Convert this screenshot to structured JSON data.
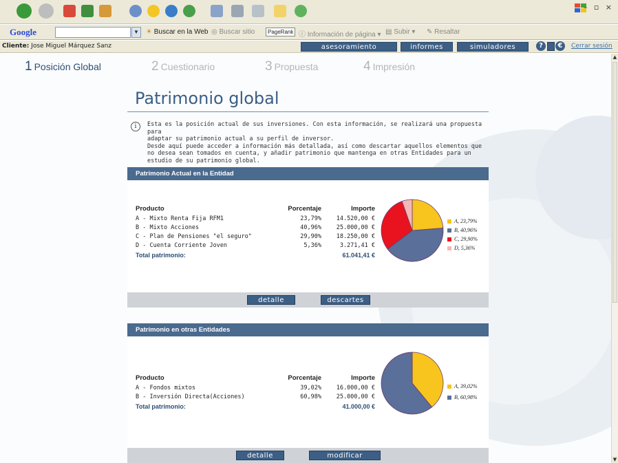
{
  "google": {
    "logo": "Google",
    "search_web": "Buscar en la Web",
    "search_site": "Buscar sitio",
    "pagerank": "PageRank",
    "page_info": "Información de página",
    "up": "Subir",
    "highlight": "Resaltar"
  },
  "app": {
    "client_label": "Cliente:",
    "client_name": "Jose Miguel Márquez Sanz",
    "nav": [
      "asesoramiento",
      "informes",
      "simuladores"
    ],
    "help": "?",
    "euro": "€",
    "logout": "Cerrar sesión"
  },
  "steps": [
    {
      "num": "1",
      "label": "Posición Global"
    },
    {
      "num": "2",
      "label": "Cuestionario"
    },
    {
      "num": "3",
      "label": "Propuesta"
    },
    {
      "num": "4",
      "label": "Impresión"
    }
  ],
  "page_title": "Patrimonio global",
  "intro_lines": [
    "Esta es la posición actual de sus inversiones. Con esta información, se realizará una propuesta para",
    "adaptar su patrimonio actual a su perfil de inversor.",
    "Desde aquí puede acceder a información más detallada, así como descartar aquellos elementos que",
    "no desea sean tomados en cuenta, y añadir patrimonio que mantenga en otras Entidades para un",
    "estudio de su patrimonio global."
  ],
  "panels": [
    {
      "title": "Patrimonio Actual en la Entidad",
      "headers": [
        "Producto",
        "Porcentaje",
        "Importe"
      ],
      "rows": [
        {
          "product": "A - Mixto Renta Fija  RFM1",
          "pct": "23,79%",
          "amount": "14.520,00 €"
        },
        {
          "product": "B - Mixto Acciones",
          "pct": "40,96%",
          "amount": "25.000,00 €"
        },
        {
          "product": "C - Plan de Pensiones \"el seguro\"",
          "pct": "29,90%",
          "amount": "18.250,00 €"
        },
        {
          "product": "D - Cuenta Corriente Joven",
          "pct": "5,36%",
          "amount": "3.271,41 €"
        }
      ],
      "total_label": "Total patrimonio:",
      "total_value": "61.041,41 €",
      "buttons": [
        "detalle",
        "descartes"
      ],
      "legend": [
        "A, 23,79%",
        "B, 40,96%",
        "C, 29,90%",
        "D, 5,36%"
      ]
    },
    {
      "title": "Patrimonio en otras Entidades",
      "headers": [
        "Producto",
        "Porcentaje",
        "Importe"
      ],
      "rows": [
        {
          "product": "A - Fondos mixtos",
          "pct": "39,02%",
          "amount": "16.000,00 €"
        },
        {
          "product": "B - Inversión Directa(Acciones)",
          "pct": "60,98%",
          "amount": "25.000,00 €"
        }
      ],
      "total_label": "Total patrimonio:",
      "total_value": "41.000,00 €",
      "buttons": [
        "detalle",
        "modificar"
      ],
      "legend": [
        "A, 39,02%",
        "B, 60,98%"
      ]
    }
  ],
  "chart_data": [
    {
      "type": "pie",
      "categories": [
        "A",
        "B",
        "C",
        "D"
      ],
      "values": [
        23.79,
        40.96,
        29.9,
        5.36
      ],
      "colors": [
        "#f8c41e",
        "#5a6f99",
        "#e8131f",
        "#f4b8b8"
      ]
    },
    {
      "type": "pie",
      "categories": [
        "A",
        "B"
      ],
      "values": [
        39.02,
        60.98
      ],
      "colors": [
        "#f8c41e",
        "#5a6f99"
      ]
    }
  ]
}
